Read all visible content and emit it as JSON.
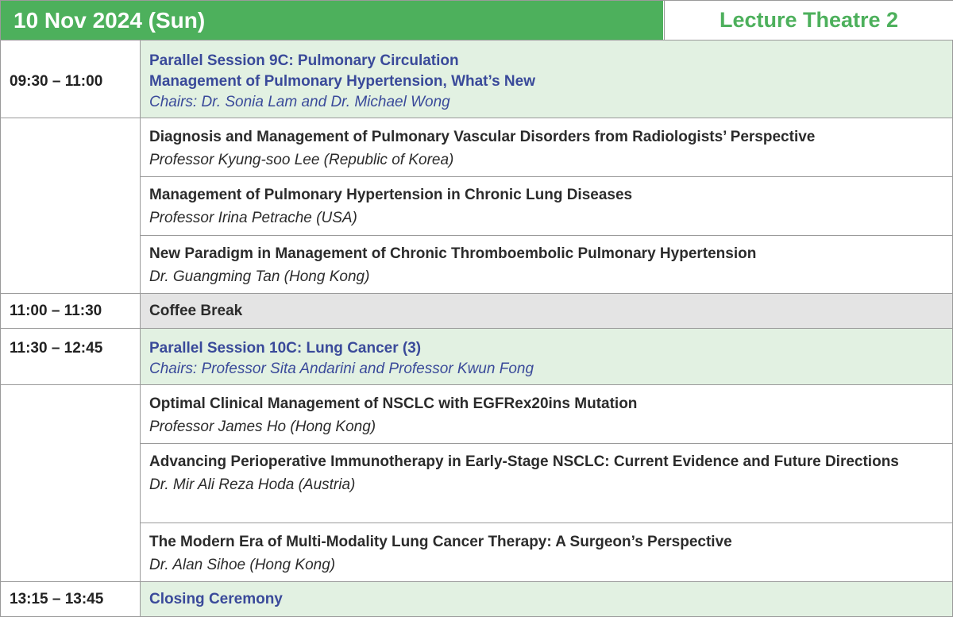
{
  "header": {
    "date": "10 Nov 2024 (Sun)",
    "venue": "Lecture Theatre 2"
  },
  "sessions": [
    {
      "time": "09:30 – 11:00",
      "title_lines": [
        "Parallel Session 9C: Pulmonary Circulation",
        "Management of Pulmonary Hypertension, What’s New"
      ],
      "chairs": "Chairs: Dr. Sonia Lam and Dr. Michael Wong"
    },
    {
      "time": "11:00 – 11:30",
      "title": "Coffee Break"
    },
    {
      "time": "11:30 – 12:45",
      "title": "Parallel Session 10C: Lung Cancer (3)",
      "chairs": "Chairs: Professor Sita Andarini and Professor Kwun Fong"
    },
    {
      "time": "13:15 – 13:45",
      "title": "Closing Ceremony"
    }
  ],
  "talks": [
    {
      "title": "Diagnosis and Management of Pulmonary Vascular Disorders from Radiologists’ Perspective",
      "speaker": "Professor Kyung-soo Lee (Republic of Korea)"
    },
    {
      "title": "Management of Pulmonary Hypertension in Chronic Lung Diseases",
      "speaker": "Professor Irina Petrache (USA)"
    },
    {
      "title": "New Paradigm in Management of Chronic Thromboembolic Pulmonary Hypertension",
      "speaker": "Dr. Guangming Tan (Hong Kong)"
    },
    {
      "title": "Optimal Clinical Management of NSCLC with EGFRex20ins Mutation",
      "speaker": "Professor James Ho (Hong Kong)"
    },
    {
      "title": "Advancing Perioperative Immunotherapy in Early-Stage NSCLC: Current Evidence and Future Directions",
      "speaker": "Dr. Mir Ali Reza Hoda (Austria)"
    },
    {
      "title": "The Modern Era of Multi-Modality Lung Cancer Therapy: A Surgeon’s Perspective",
      "speaker": "Dr. Alan Sihoe (Hong Kong)"
    }
  ],
  "colors": {
    "header_green": "#4db05c",
    "session_fill": "#e2f1e2",
    "break_fill": "#e4e4e4",
    "session_text": "#3a4a9a",
    "border": "#9a9a9a"
  }
}
